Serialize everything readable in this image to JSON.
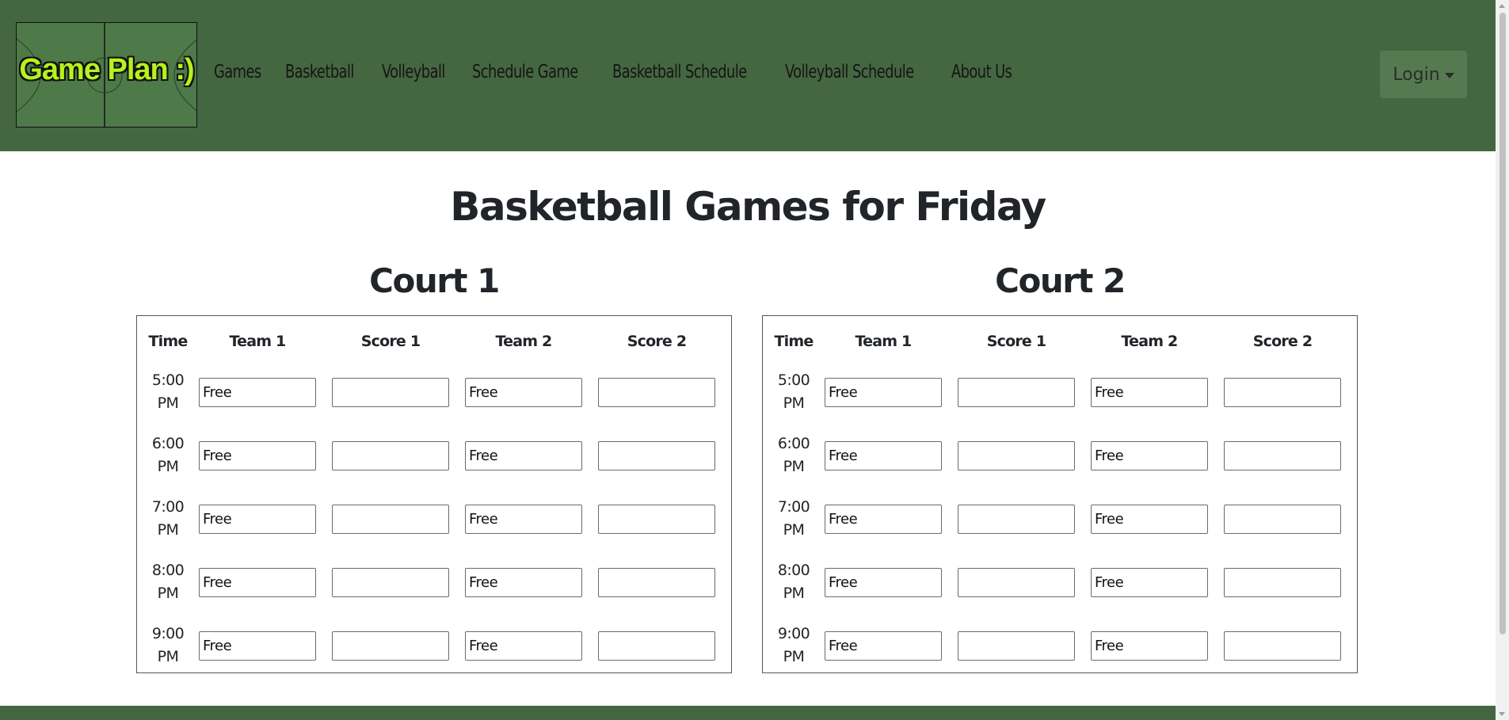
{
  "brand": {
    "logo_text": "Game Plan :)"
  },
  "nav": {
    "links": [
      "Games",
      "Basketball",
      "Volleyball",
      "Schedule Game",
      "Basketball Schedule",
      "Volleyball Schedule",
      "About Us"
    ],
    "login_label": "Login"
  },
  "page": {
    "title": "Basketball Games for Friday"
  },
  "courts": [
    {
      "title": "Court 1",
      "headers": [
        "Time",
        "Team 1",
        "Score 1",
        "Team 2",
        "Score 2"
      ],
      "rows": [
        {
          "time": [
            "5:00",
            "PM"
          ],
          "team1": "Free",
          "score1": "",
          "team2": "Free",
          "score2": ""
        },
        {
          "time": [
            "6:00",
            "PM"
          ],
          "team1": "Free",
          "score1": "",
          "team2": "Free",
          "score2": ""
        },
        {
          "time": [
            "7:00",
            "PM"
          ],
          "team1": "Free",
          "score1": "",
          "team2": "Free",
          "score2": ""
        },
        {
          "time": [
            "8:00",
            "PM"
          ],
          "team1": "Free",
          "score1": "",
          "team2": "Free",
          "score2": ""
        },
        {
          "time": [
            "9:00",
            "PM"
          ],
          "team1": "Free",
          "score1": "",
          "team2": "Free",
          "score2": ""
        }
      ]
    },
    {
      "title": "Court 2",
      "headers": [
        "Time",
        "Team 1",
        "Score 1",
        "Team 2",
        "Score 2"
      ],
      "rows": [
        {
          "time": [
            "5:00",
            "PM"
          ],
          "team1": "Free",
          "score1": "",
          "team2": "Free",
          "score2": ""
        },
        {
          "time": [
            "6:00",
            "PM"
          ],
          "team1": "Free",
          "score1": "",
          "team2": "Free",
          "score2": ""
        },
        {
          "time": [
            "7:00",
            "PM"
          ],
          "team1": "Free",
          "score1": "",
          "team2": "Free",
          "score2": ""
        },
        {
          "time": [
            "8:00",
            "PM"
          ],
          "team1": "Free",
          "score1": "",
          "team2": "Free",
          "score2": ""
        },
        {
          "time": [
            "9:00",
            "PM"
          ],
          "team1": "Free",
          "score1": "",
          "team2": "Free",
          "score2": ""
        }
      ]
    }
  ],
  "colors": {
    "header_bg": "#446640",
    "logo_text": "#b6f21c",
    "login_bg": "#557a52"
  }
}
